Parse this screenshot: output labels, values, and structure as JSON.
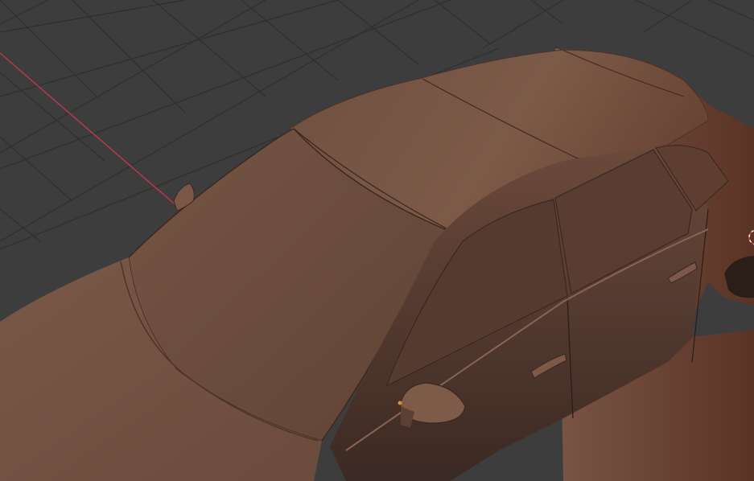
{
  "app": {
    "name": "3D Viewport",
    "view": "perspective"
  },
  "viewport": {
    "background_color": "#3d3d3d",
    "grid_color": "#2f2f2f",
    "x_axis_color": "#c0394a",
    "selection_color": "#e08a3c"
  },
  "scene": {
    "object_kind": "car body mesh",
    "shading_mode": "solid",
    "material_color": "#7a5645",
    "shadow_color": "#3a2822",
    "highlight_color": "#9a7260"
  },
  "icons": {
    "origin": "object-origin-icon",
    "cursor": "3d-cursor-icon"
  }
}
